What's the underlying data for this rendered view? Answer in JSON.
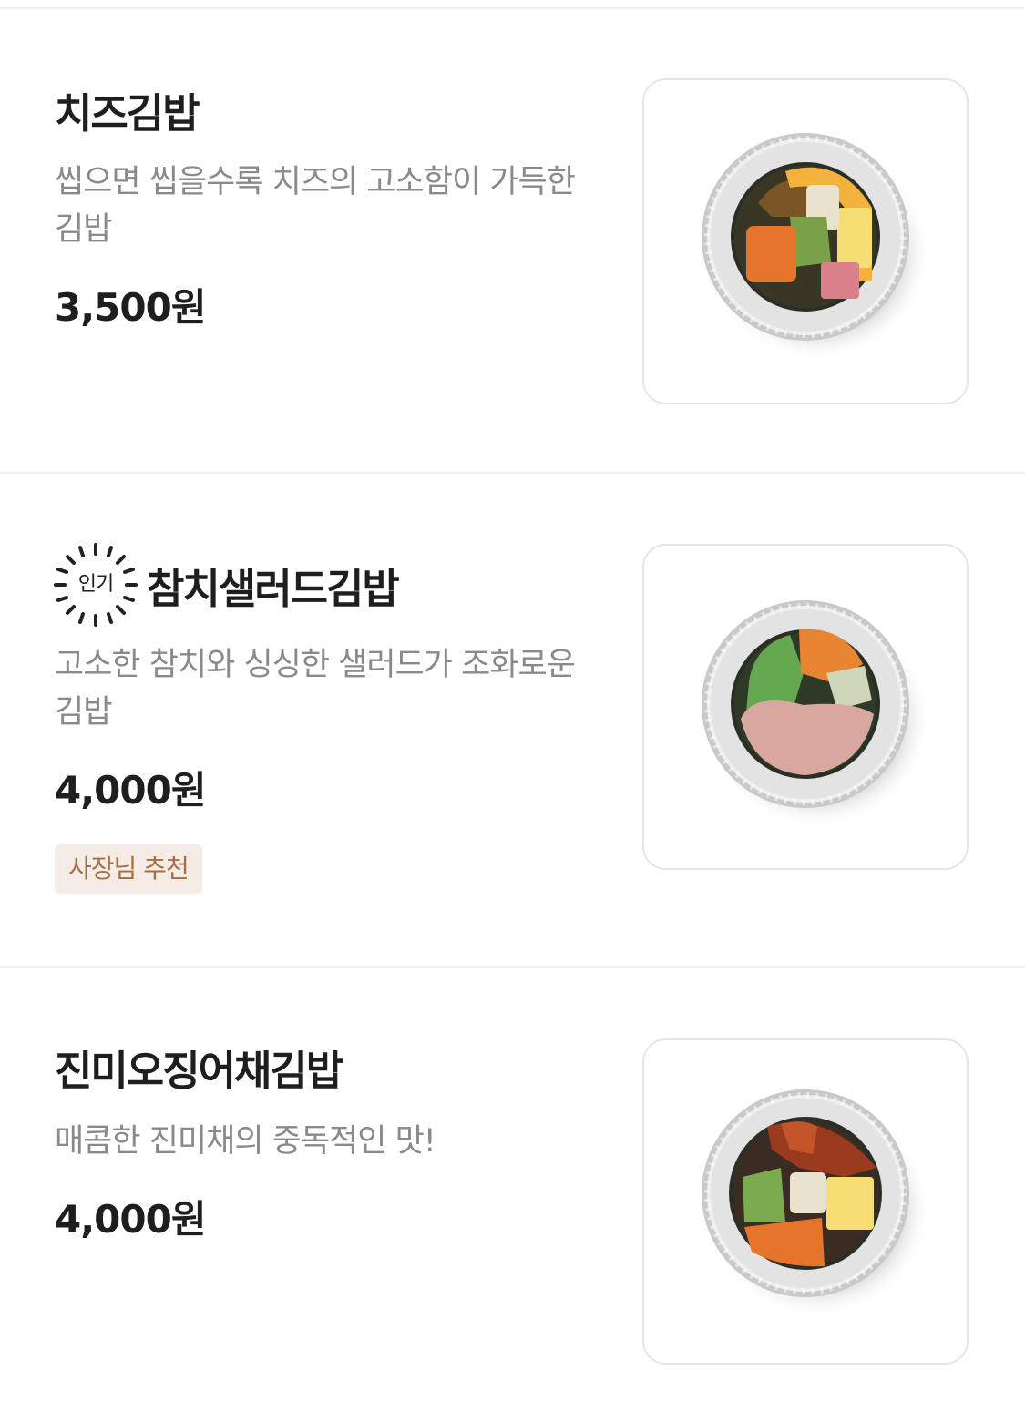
{
  "menu": {
    "items": [
      {
        "title": "치즈김밥",
        "description": "씹으면 씹을수록 치즈의 고소함이 가득한 김밥",
        "price": "3,500원",
        "image_icon": "cheese-kimbap-photo"
      },
      {
        "title": "참치샐러드김밥",
        "popular_label": "인기",
        "description": "고소한 참치와 싱싱한 샐러드가 조화로운 김밥",
        "price": "4,000원",
        "badge": "사장님 추천",
        "image_icon": "tuna-salad-kimbap-photo"
      },
      {
        "title": "진미오징어채김밥",
        "description": "매콤한 진미채의 중독적인 맛!",
        "price": "4,000원",
        "image_icon": "dried-squid-kimbap-photo"
      }
    ]
  },
  "colors": {
    "title": "#1e1e1e",
    "description": "#8a8a8a",
    "badge_bg": "#f4ede6",
    "badge_text": "#a86d45",
    "divider": "#f0f0f0",
    "thumb_border": "#e6e6e6"
  }
}
